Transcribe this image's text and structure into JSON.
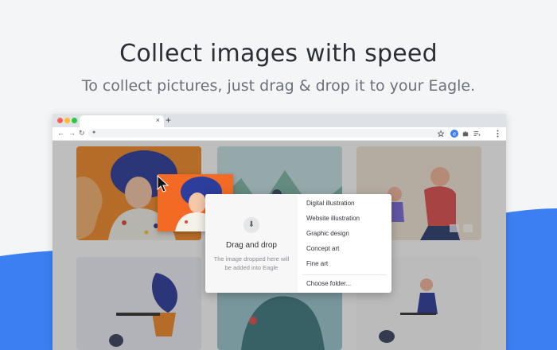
{
  "hero": {
    "title": "Collect images with speed",
    "subtitle": "To collect pictures, just drag & drop it to your Eagle."
  },
  "browser": {
    "tab_close": "×",
    "new_tab": "+",
    "nav": {
      "back": "←",
      "forward": "→",
      "reload": "↻"
    },
    "toolbar_icons": [
      "star-icon",
      "eagle-extension-icon",
      "puzzle-icon",
      "playlist-icon",
      "kebab-menu-icon"
    ],
    "traffic_lights": {
      "close": "#ff5f57",
      "minimize": "#febc2e",
      "maximize": "#28c840"
    }
  },
  "popup": {
    "drop_title": "Drag and drop",
    "drop_desc": "The image dropped here will be added into Eagle",
    "folders": [
      "Digital illustration",
      "Website illustration",
      "Graphic design",
      "Concept art",
      "Fine art"
    ],
    "choose_folder": "Choose folder..."
  },
  "colors": {
    "accent_blue": "#3b7ff2",
    "headline": "#2b2f36",
    "subtext": "#6c7079"
  }
}
